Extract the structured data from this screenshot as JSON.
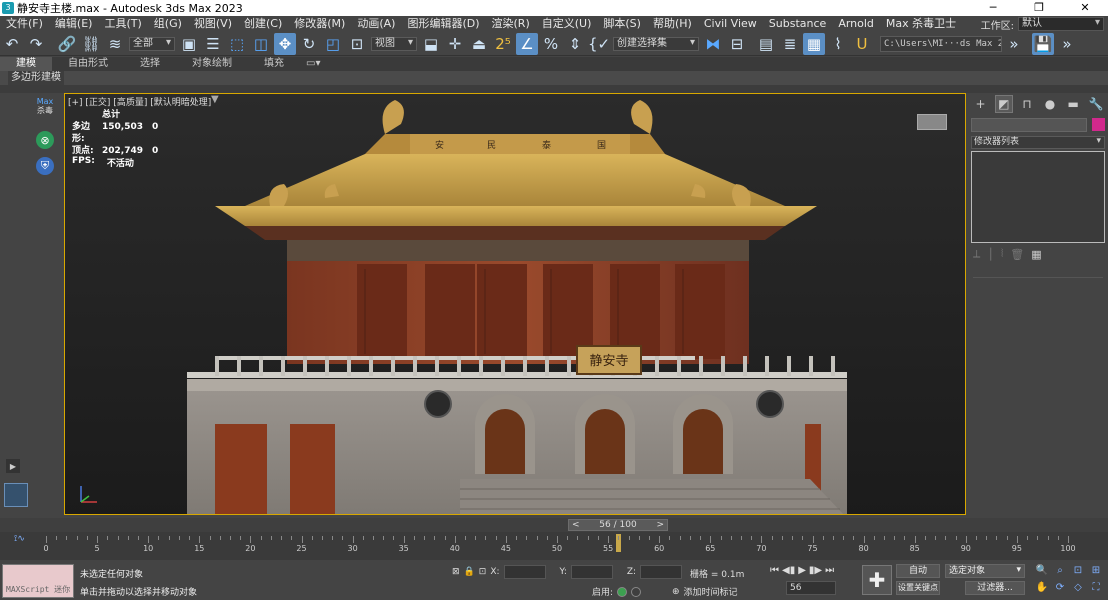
{
  "window": {
    "title": "静安寺主楼.max - Autodesk 3ds Max 2023",
    "minimize": "─",
    "restore": "❐",
    "close": "✕"
  },
  "menu": {
    "items": [
      "文件(F)",
      "编辑(E)",
      "工具(T)",
      "组(G)",
      "视图(V)",
      "创建(C)",
      "修改器(M)",
      "动画(A)",
      "图形编辑器(D)",
      "渲染(R)",
      "自定义(U)",
      "脚本(S)",
      "帮助(H)",
      "Civil View",
      "Substance",
      "Arnold",
      "Max 杀毒卫士"
    ],
    "workspace_label": "工作区:",
    "workspace_value": "默认"
  },
  "toolbar": {
    "filter_select": "全部",
    "ref_coord_select": "视图",
    "named_selection": "创建选择集",
    "project_path": "C:\\Users\\MI···ds Max 2023"
  },
  "ribbon": {
    "tabs": [
      "建模",
      "自由形式",
      "选择",
      "对象绘制",
      "填充"
    ],
    "active_tab": "建模",
    "sub_label": "多边形建模"
  },
  "left_strip": {
    "plugin_label_1": "Max",
    "plugin_label_2": "杀毒"
  },
  "viewport": {
    "label": "[+] [正交] [高质量] [默认明暗处理]",
    "stats_title": "总计",
    "polys_label": "多边形:",
    "polys_total": "150,503",
    "polys_sel": "0",
    "verts_label": "顶点:",
    "verts_total": "202,749",
    "verts_sel": "0",
    "fps_label": "FPS:",
    "fps_value": "不活动",
    "temple_sign": "静安寺",
    "roof_characters": [
      "安",
      "民",
      "泰",
      "国"
    ]
  },
  "command_panel": {
    "modifier_list": "修改器列表",
    "color_swatch": "#d1298c"
  },
  "timeline": {
    "slider_text": "56 / 100",
    "current_frame": 56,
    "ticks": [
      0,
      5,
      10,
      15,
      20,
      25,
      30,
      35,
      40,
      45,
      50,
      55,
      60,
      65,
      70,
      75,
      80,
      85,
      90,
      95,
      100
    ]
  },
  "status": {
    "maxscript_label": "MAXScript 迷你",
    "line1": "未选定任何对象",
    "line2": "单击并拖动以选择并移动对象",
    "x_label": "X:",
    "y_label": "Y:",
    "z_label": "Z:",
    "grid": "栅格 = 0.1m",
    "enabled_label": "启用:",
    "add_time_tag": "添加时间标记",
    "frame_field": "56",
    "auto_key": "自动",
    "set_key": "设置关键点",
    "selected_dd": "选定对象",
    "filters": "过滤器..."
  }
}
